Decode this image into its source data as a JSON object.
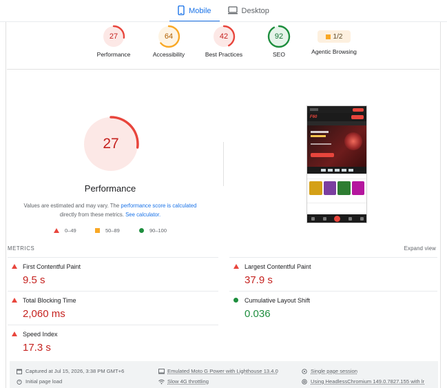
{
  "tabs": [
    {
      "label": "Mobile",
      "icon": "phone-icon",
      "active": true
    },
    {
      "label": "Desktop",
      "icon": "desktop-icon",
      "active": false
    }
  ],
  "summary": {
    "performance": {
      "score": "27",
      "label": "Performance",
      "value": 27
    },
    "accessibility": {
      "score": "64",
      "label": "Accessibility",
      "value": 64
    },
    "best_practices": {
      "score": "42",
      "label": "Best Practices",
      "value": 42
    },
    "seo": {
      "score": "92",
      "label": "SEO",
      "value": 92
    },
    "agentic": {
      "score": "1/2",
      "label": "Agentic Browsing"
    }
  },
  "detail": {
    "score": "27",
    "value": 27,
    "title": "Performance",
    "note_prefix": "Values are estimated and may vary. The ",
    "note_link1": "performance score is calculated",
    "note_middle": " directly from these metrics. ",
    "note_link2": "See calculator.",
    "legend": {
      "poor": "0–49",
      "average": "50–89",
      "good": "90–100"
    }
  },
  "metrics": {
    "heading": "METRICS",
    "expand_label": "Expand view",
    "fcp": {
      "name": "First Contentful Paint",
      "value": "9.5 s",
      "status": "poor"
    },
    "lcp": {
      "name": "Largest Contentful Paint",
      "value": "37.9 s",
      "status": "poor"
    },
    "tbt": {
      "name": "Total Blocking Time",
      "value": "2,060 ms",
      "status": "poor"
    },
    "cls": {
      "name": "Cumulative Layout Shift",
      "value": "0.036",
      "status": "good"
    },
    "si": {
      "name": "Speed Index",
      "value": "17.3 s",
      "status": "poor"
    }
  },
  "footer": {
    "captured": "Captured at Jul 15, 2026, 3:38 PM GMT+6",
    "device": "Emulated Moto G Power with Lighthouse 13.4.0",
    "session": "Single page session",
    "load": "Initial page load",
    "throttling": "Slow 4G throttling",
    "browser": "Using HeadlessChromium 149.0.7827.155 with lr"
  },
  "colors": {
    "poor": "#e8453c",
    "poor_text": "#c5221f",
    "average": "#f9a825",
    "good": "#1e8e3e",
    "accent": "#1a73e8"
  }
}
